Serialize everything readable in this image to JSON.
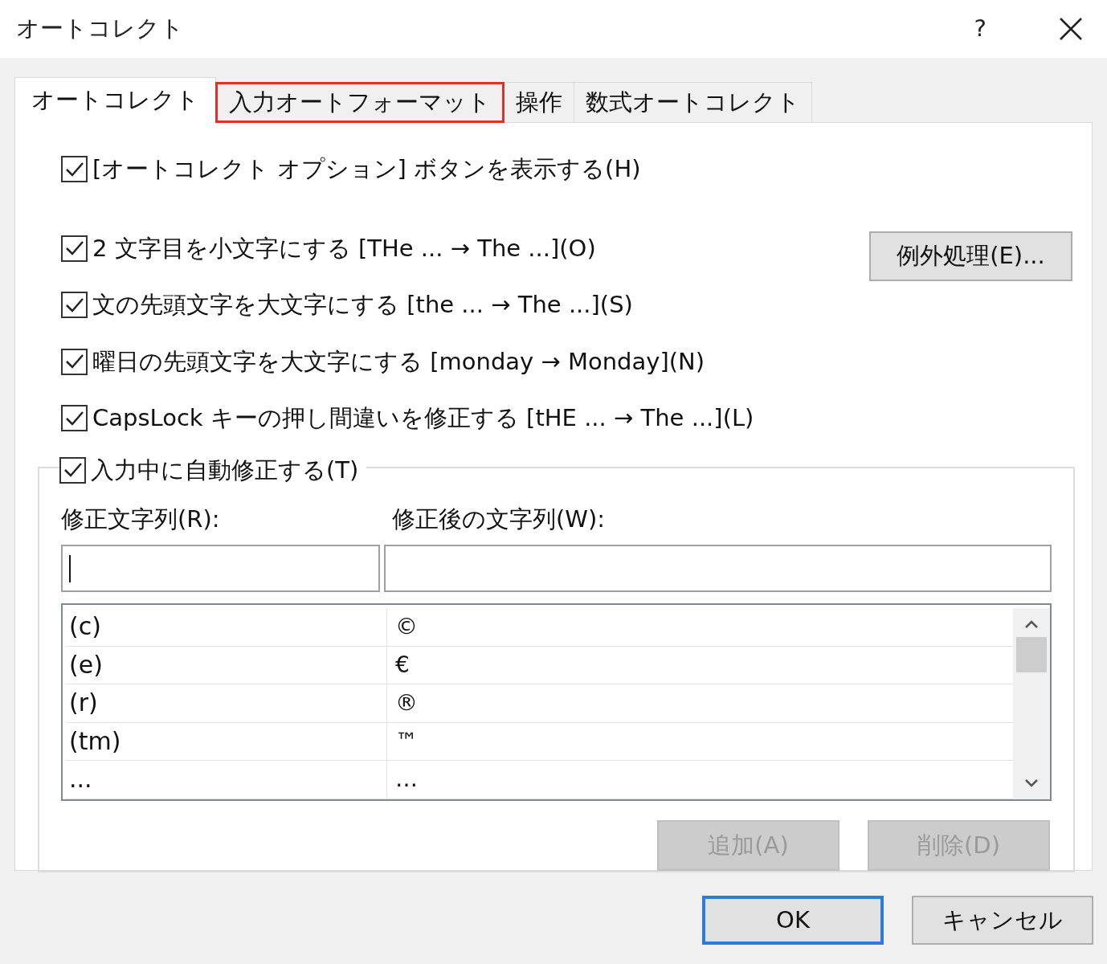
{
  "window": {
    "title": "オートコレクト",
    "help": "?"
  },
  "tabs": [
    {
      "label": "オートコレクト",
      "selected": true,
      "highlighted": false
    },
    {
      "label": "入力オートフォーマット",
      "selected": false,
      "highlighted": true
    },
    {
      "label": "操作",
      "selected": false,
      "highlighted": false
    },
    {
      "label": "数式オートコレクト",
      "selected": false,
      "highlighted": false
    }
  ],
  "show_options_button": {
    "label": "[オートコレクト オプション] ボタンを表示する(H)",
    "checked": true
  },
  "rules": [
    {
      "label": "2 文字目を小文字にする [THe ... → The ...](O)",
      "checked": true
    },
    {
      "label": "文の先頭文字を大文字にする [the ... → The ...](S)",
      "checked": true
    },
    {
      "label": "曜日の先頭文字を大文字にする [monday → Monday](N)",
      "checked": true
    },
    {
      "label": "CapsLock キーの押し間違いを修正する [tHE ... → The ...](L)",
      "checked": true
    }
  ],
  "exceptions_button": "例外処理(E)...",
  "replace_as_you_type": {
    "label": "入力中に自動修正する(T)",
    "checked": true,
    "replace_label": "修正文字列(R):",
    "with_label": "修正後の文字列(W):",
    "rows": [
      {
        "replace": "(c)",
        "with": "©"
      },
      {
        "replace": "(e)",
        "with": "€"
      },
      {
        "replace": "(r)",
        "with": "®"
      },
      {
        "replace": "(tm)",
        "with": "™"
      },
      {
        "replace": "...",
        "with": "…"
      }
    ],
    "buttons": [
      {
        "label": "追加(A)",
        "disabled": true
      },
      {
        "label": "削除(D)",
        "disabled": true
      }
    ]
  },
  "footer_buttons": [
    {
      "label": "OK",
      "default": true
    },
    {
      "label": "キャンセル",
      "default": false
    }
  ]
}
